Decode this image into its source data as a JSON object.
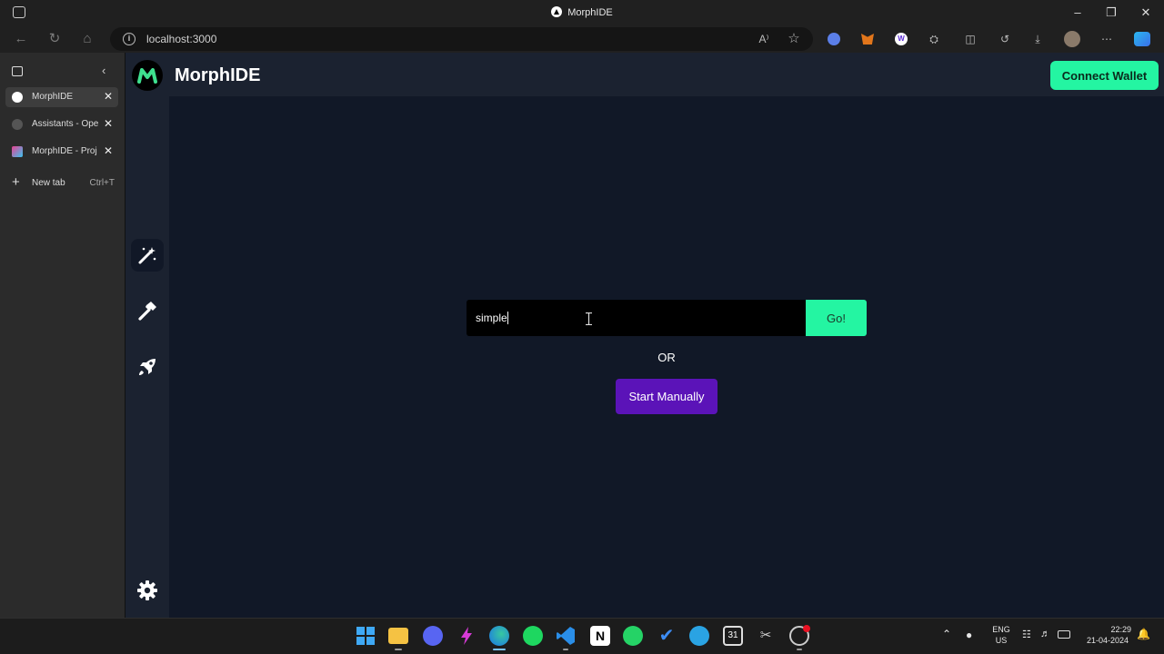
{
  "browser": {
    "window_title": "MorphIDE",
    "url": "localhost:3000",
    "tabs": [
      {
        "label": "MorphIDE",
        "active": true
      },
      {
        "label": "Assistants - Ope",
        "active": false
      },
      {
        "label": "MorphIDE - Proj",
        "active": false
      }
    ],
    "new_tab": {
      "label": "New tab",
      "shortcut": "Ctrl+T"
    }
  },
  "app": {
    "name": "MorphIDE",
    "connect_label": "Connect Wallet",
    "rail_icons": [
      "magic-wand-icon",
      "hammer-icon",
      "rocket-icon",
      "gear-icon"
    ],
    "prompt_value": "simple",
    "go_label": "Go!",
    "or_label": "OR",
    "manual_label": "Start Manually",
    "accent": "#24f5a2",
    "purple": "#5b13b8"
  },
  "taskbar": {
    "lang": "ENG",
    "region": "US",
    "time": "22:29",
    "date": "21-04-2024",
    "calendar_day": "31"
  }
}
